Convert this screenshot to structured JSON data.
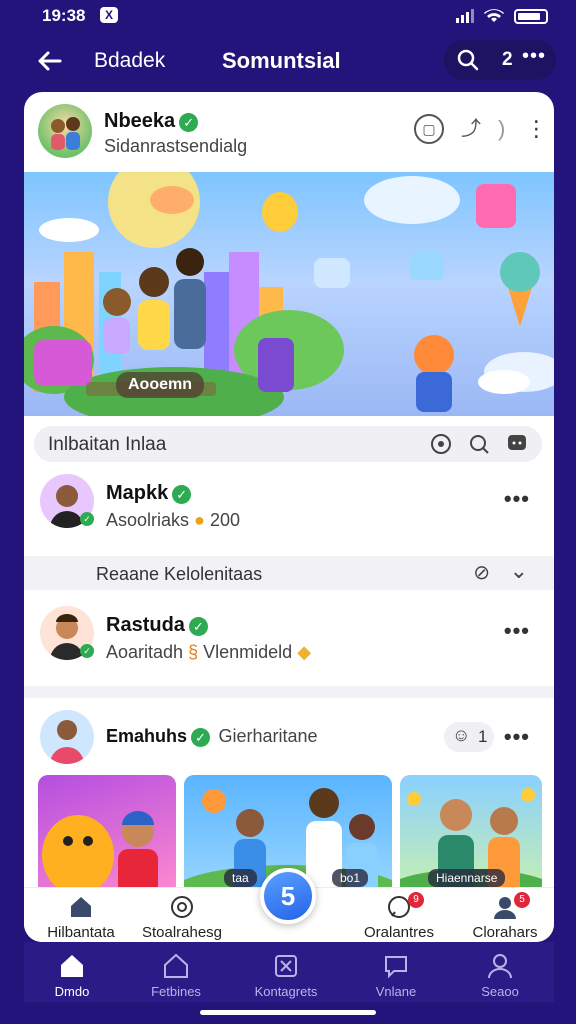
{
  "status": {
    "time": "19:38",
    "x_badge": "X"
  },
  "nav": {
    "left_label": "Bdadek",
    "title": "Somuntsial",
    "count": "2",
    "more": "•••"
  },
  "post": {
    "author": "Nbeeka",
    "subtitle": "Sidanrastsendialg",
    "hero_label": "Aooemn",
    "search_placeholder": "Inlbaitan Inlaa"
  },
  "items": [
    {
      "name": "Mapkk",
      "detail": "Asoolriaks",
      "value": "200"
    },
    {
      "name": "Rastuda",
      "detail": "Aoaritadh",
      "detail2": "Vlenmideld"
    }
  ],
  "separator": {
    "label": "Reaane Kelolenitaas"
  },
  "group": {
    "name": "Emahuhs",
    "extra": "Gierharitane",
    "count": "1"
  },
  "thumbs": [
    {
      "label": ""
    },
    {
      "label": "taa",
      "label2": "bo1"
    },
    {
      "label": "Hiaennarse"
    }
  ],
  "card_tabs": [
    {
      "label": "Hilbantata",
      "icon": "home-icon"
    },
    {
      "label": "Stoalrahesg",
      "icon": "spiral-icon"
    },
    {
      "label": "Oralantres",
      "icon": "chat-icon",
      "badge": "9"
    },
    {
      "label": "Clorahars",
      "icon": "user-icon",
      "badge": "5"
    }
  ],
  "fab": {
    "label": "5"
  },
  "bottom_nav": [
    {
      "label": "Dmdo",
      "icon": "home-icon",
      "active": true
    },
    {
      "label": "Fetbines",
      "icon": "house-outline-icon"
    },
    {
      "label": "Kontagrets",
      "icon": "crop-icon"
    },
    {
      "label": "Vnlane",
      "icon": "message-icon"
    },
    {
      "label": "Seaoo",
      "icon": "person-icon"
    }
  ],
  "colors": {
    "bg": "#22147a",
    "verified": "#2eaa52",
    "fab": "#2563e8",
    "badge": "#e0263a"
  }
}
